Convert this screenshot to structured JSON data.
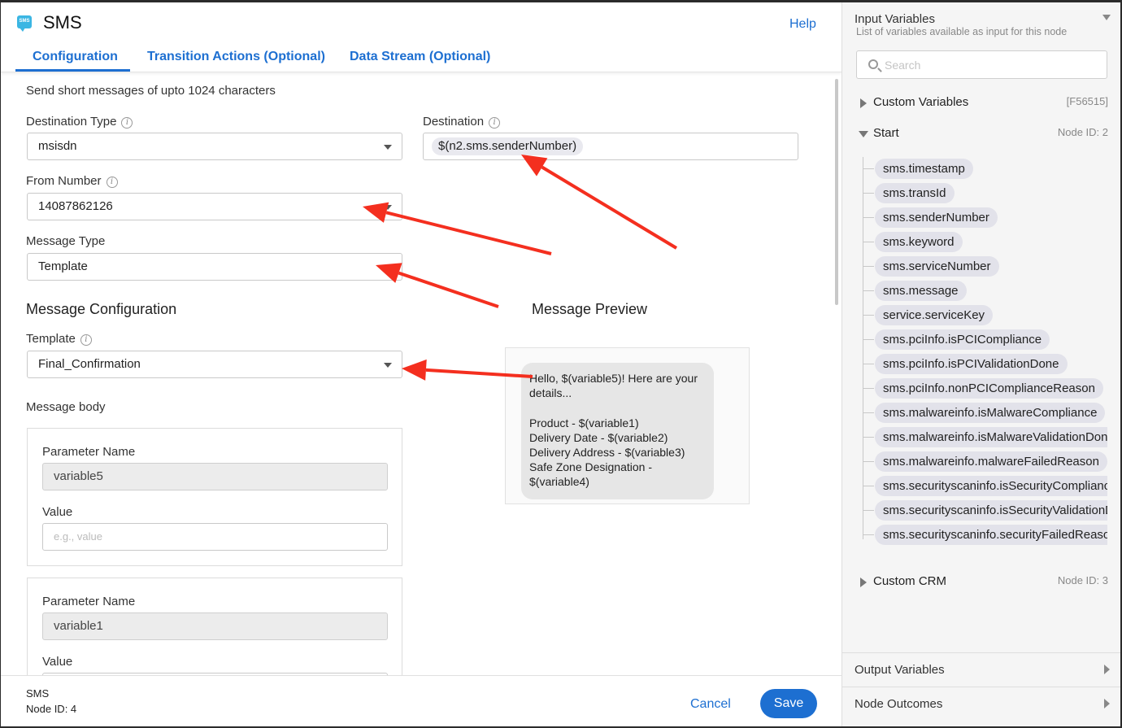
{
  "header": {
    "logo_text": "SMS",
    "title": "SMS",
    "help": "Help",
    "tabs": [
      "Configuration",
      "Transition Actions (Optional)",
      "Data Stream (Optional)"
    ]
  },
  "form": {
    "description": "Send short messages of upto 1024 characters",
    "destination_type": {
      "label": "Destination Type",
      "value": "msisdn"
    },
    "destination": {
      "label": "Destination",
      "value": "$(n2.sms.senderNumber)"
    },
    "from_number": {
      "label": "From Number",
      "value": "14087862126"
    },
    "message_type": {
      "label": "Message Type",
      "value": "Template"
    },
    "message_configuration": "Message Configuration",
    "message_preview": "Message Preview",
    "template": {
      "label": "Template",
      "value": "Final_Confirmation"
    },
    "message_body": "Message body",
    "params": [
      {
        "name_label": "Parameter Name",
        "name": "variable5",
        "value_label": "Value",
        "value_placeholder": "e.g., value"
      },
      {
        "name_label": "Parameter Name",
        "name": "variable1",
        "value_label": "Value",
        "value_placeholder": ""
      }
    ]
  },
  "preview": {
    "text": "Hello, $(variable5)! Here are your details...\n\nProduct - $(variable1)\nDelivery Date - $(variable2)\nDelivery Address - $(variable3)\nSafe Zone Designation - $(variable4)"
  },
  "footer": {
    "name": "SMS",
    "node_id": "Node ID: 4",
    "cancel": "Cancel",
    "save": "Save"
  },
  "right_panel": {
    "title": "Input Variables",
    "subtitle": "List of variables available as input for this node",
    "search_placeholder": "Search",
    "custom_variables": {
      "label": "Custom Variables",
      "meta": "[F56515]"
    },
    "start": {
      "label": "Start",
      "meta": "Node ID: 2"
    },
    "variables": [
      "sms.timestamp",
      "sms.transId",
      "sms.senderNumber",
      "sms.keyword",
      "sms.serviceNumber",
      "sms.message",
      "service.serviceKey",
      "sms.pciInfo.isPCICompliance",
      "sms.pciInfo.isPCIValidationDone",
      "sms.pciInfo.nonPCIComplianceReason",
      "sms.malwareinfo.isMalwareCompliance",
      "sms.malwareinfo.isMalwareValidationDone",
      "sms.malwareinfo.malwareFailedReason",
      "sms.securityscaninfo.isSecurityCompliance",
      "sms.securityscaninfo.isSecurityValidationDone",
      "sms.securityscaninfo.securityFailedReason"
    ],
    "custom_crm": {
      "label": "Custom CRM",
      "meta": "Node ID: 3"
    },
    "output_variables": "Output Variables",
    "node_outcomes": "Node Outcomes"
  },
  "colors": {
    "accent": "#1d6fd1",
    "annotation_arrow": "#f42f1f",
    "chip": "#e2e2ea"
  }
}
